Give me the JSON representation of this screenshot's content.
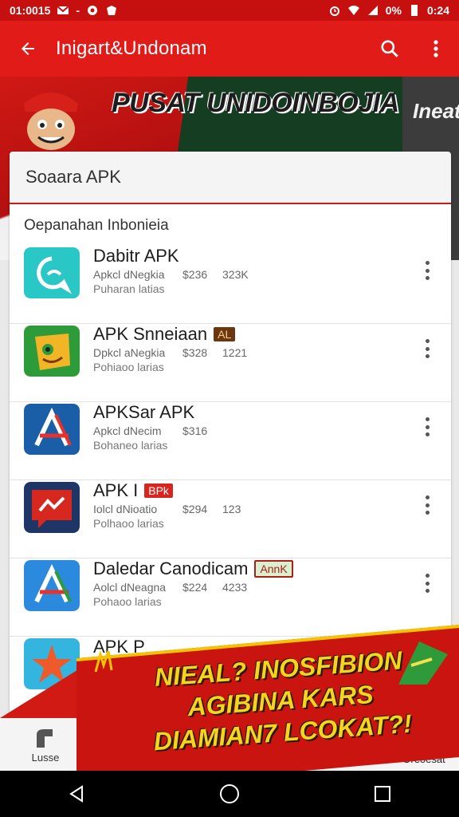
{
  "status_bar": {
    "time_left": "01:0015",
    "battery_pct": "0%",
    "time_right": "0:24"
  },
  "app_bar": {
    "title": "Inigart&Undonam",
    "back_icon": "back-arrow-icon",
    "search_icon": "search-icon",
    "menu_icon": "more-vert-icon"
  },
  "banner": {
    "title": "PUSAT UNIDOINBOJIA",
    "title_2": "Ineat"
  },
  "search": {
    "placeholder": "Soaara APK"
  },
  "section": {
    "title": "Oepanahan Inbonieia"
  },
  "apps": [
    {
      "name": "Dabitr APK",
      "badge": "",
      "meta": [
        "Apkcl dNegkia",
        "$236",
        "323K"
      ],
      "sub": "Puharan latias",
      "icon": "chat-bubble-icon",
      "color": "#28c8c4"
    },
    {
      "name": "APK Snneiaan",
      "badge": "AL",
      "meta": [
        "Dpkcl aNegkia",
        "$328",
        "1221"
      ],
      "sub": "Pohiaoo larias",
      "icon": "mascot-icon",
      "color": "#2f9a3a"
    },
    {
      "name": "APKSar APK",
      "badge": "",
      "meta": [
        "Apkcl dNecim",
        "$316",
        ""
      ],
      "sub": "Bohaneo larias",
      "icon": "store-a-icon",
      "color": "#1a5fa8"
    },
    {
      "name": "APK I",
      "badge": "BPk",
      "meta": [
        "Iolcl dNioatio",
        "$294",
        "123"
      ],
      "sub": "Polhaoo larias",
      "icon": "messenger-icon",
      "color": "#c42a22"
    },
    {
      "name": "Daledar Canodicam",
      "badge": "AnnK",
      "meta": [
        "Aolcl dNeagna",
        "$224",
        "4233"
      ],
      "sub": "Pohaoo larias",
      "icon": "store-a-icon",
      "color": "#2a86d8"
    },
    {
      "name": "APK P",
      "badge": "",
      "meta": [
        "",
        "",
        ""
      ],
      "sub": "",
      "icon": "star-icon",
      "color": "#34b6e0"
    }
  ],
  "bottom_nav": {
    "home_label": "Lusse",
    "right_label": "Oreoesat"
  },
  "promo": {
    "line1": "NIEAL? INOSFIBION",
    "line2": "AGIBINA KARS",
    "line3": "DIAMIAN7 LCOKAT?!"
  },
  "colors": {
    "primary": "#e11b17",
    "status": "#c6100f",
    "promo_text": "#f7d31e"
  }
}
